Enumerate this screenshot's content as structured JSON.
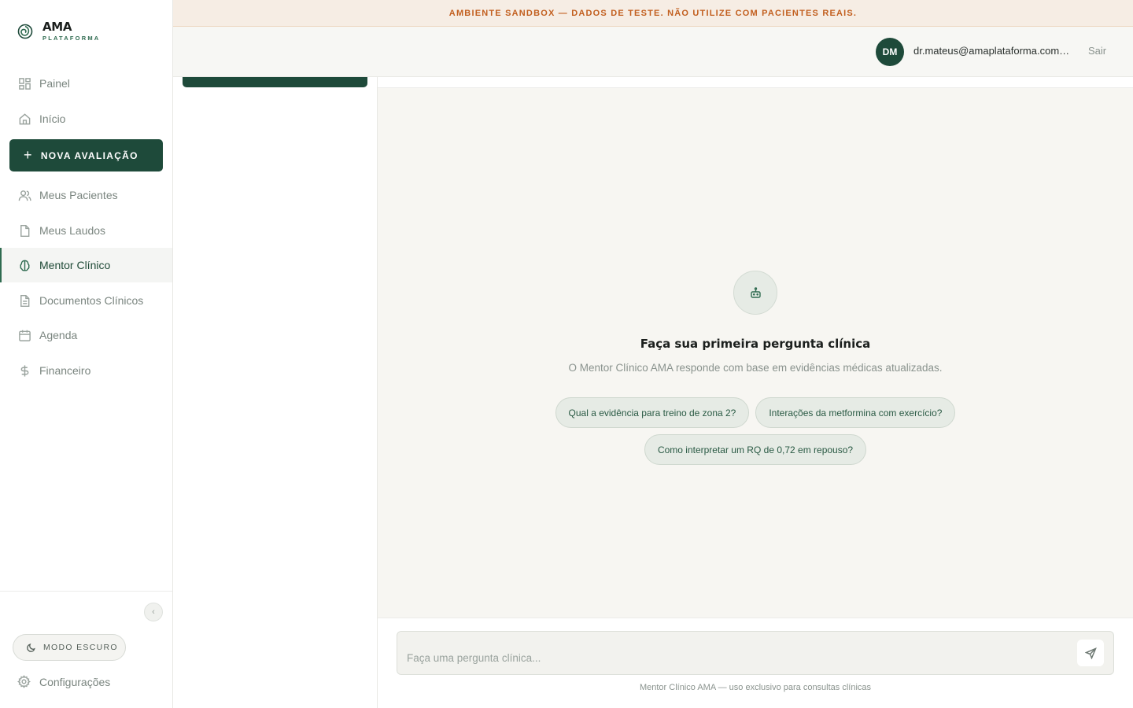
{
  "banner": {
    "text": "AMBIENTE SANDBOX — DADOS DE TESTE. NÃO UTILIZE COM PACIENTES REAIS."
  },
  "brand": {
    "name": "AMA",
    "subtitle": "PLATAFORMA"
  },
  "sidebar": {
    "items": [
      {
        "label": "Painel",
        "icon": "dashboard-icon"
      },
      {
        "label": "Início",
        "icon": "home-icon"
      },
      {
        "label": "Meus Pacientes",
        "icon": "users-icon"
      },
      {
        "label": "Meus Laudos",
        "icon": "file-icon"
      },
      {
        "label": "Mentor Clínico",
        "icon": "brain-icon",
        "active": true
      },
      {
        "label": "Documentos Clínicos",
        "icon": "document-text-icon"
      },
      {
        "label": "Agenda",
        "icon": "calendar-icon"
      },
      {
        "label": "Financeiro",
        "icon": "dollar-icon"
      }
    ],
    "new_button": "NOVA AVALIAÇÃO",
    "dark_mode": "MODO ESCURO",
    "settings": "Configurações"
  },
  "header": {
    "avatar_initials": "DM",
    "user_email": "dr.mateus@amaplataforma.com.br",
    "logout": "Sair"
  },
  "chat": {
    "empty_title": "Faça sua primeira pergunta clínica",
    "empty_subtitle": "O Mentor Clínico AMA responde com base em evidências médicas atualizadas.",
    "suggestions": [
      "Qual a evidência para treino de zona 2?",
      "Interações da metformina com exercício?",
      "Como interpretar um RQ de 0,72 em repouso?"
    ],
    "input_placeholder": "Faça uma pergunta clínica...",
    "disclaimer": "Mentor Clínico AMA — uso exclusivo para consultas clínicas"
  },
  "colors": {
    "brand_green": "#1e4a3a",
    "accent_green": "#2f6b50",
    "banner_text": "#c25f1f",
    "banner_bg": "#f6ede4"
  }
}
